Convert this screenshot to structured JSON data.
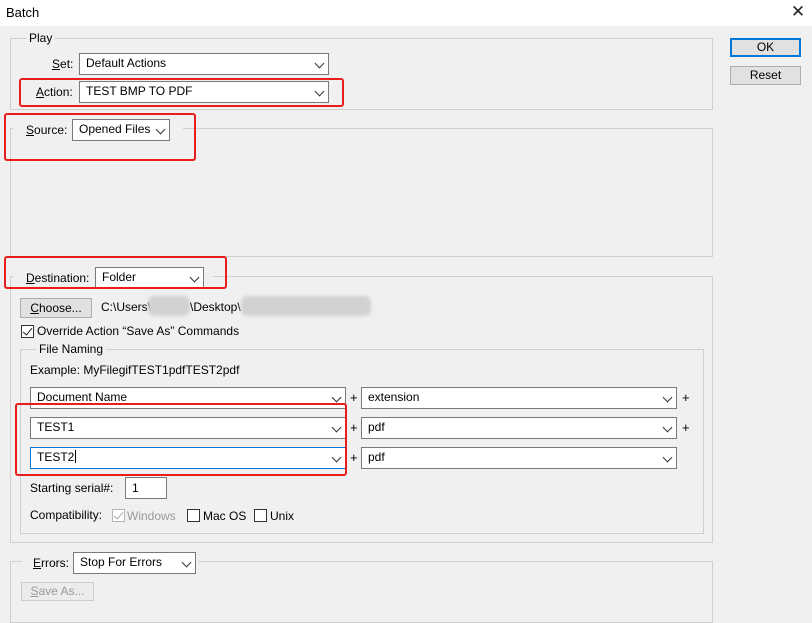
{
  "window": {
    "title": "Batch",
    "close_glyph": "✕"
  },
  "buttons": {
    "ok": "OK",
    "reset": "Reset"
  },
  "play": {
    "legend": "Play",
    "set_label": "Set:",
    "set_value": "Default Actions",
    "action_label": "Action:",
    "action_value": "TEST BMP TO PDF"
  },
  "source": {
    "label": "Source:",
    "value": "Opened Files"
  },
  "destination": {
    "label": "Destination:",
    "value": "Folder",
    "choose_button": "Choose...",
    "path_prefix": "C:\\Users\\",
    "path_middle": "\\Desktop\\",
    "override_label": "Override Action “Save As” Commands",
    "override_checked": true
  },
  "file_naming": {
    "legend": "File Naming",
    "example": "Example: MyFilegifTEST1pdfTEST2pdf",
    "rows": [
      {
        "left": "Document Name",
        "right": "extension"
      },
      {
        "left": "TEST1",
        "right": "pdf"
      },
      {
        "left": "TEST2",
        "right": "pdf"
      }
    ],
    "plus": "+",
    "starting_serial_label": "Starting serial#:",
    "starting_serial_value": "1",
    "compatibility_label": "Compatibility:",
    "compat_windows": "Windows",
    "compat_windows_checked": true,
    "compat_mac": "Mac OS",
    "compat_mac_checked": false,
    "compat_unix": "Unix",
    "compat_unix_checked": false
  },
  "errors": {
    "label": "Errors:",
    "value": "Stop For Errors",
    "save_as_button": "Save As..."
  },
  "colors": {
    "highlight": "#e81e1e",
    "focus": "#0078d7"
  },
  "icons": {
    "dropdown": "chevron-down-icon",
    "close": "close-icon",
    "checkbox": "checkmark-icon"
  }
}
